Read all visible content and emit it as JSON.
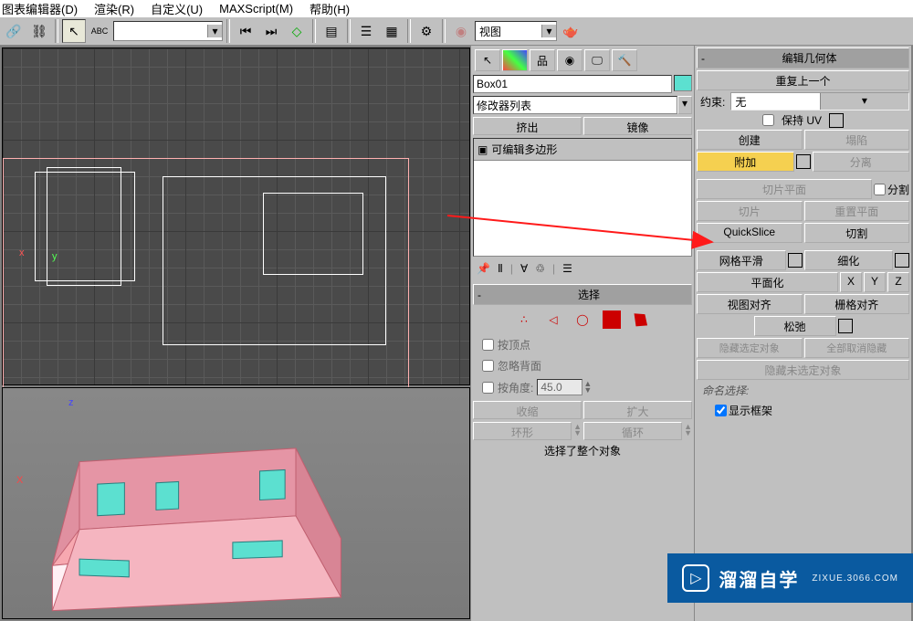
{
  "menubar": {
    "graph_editors": "图表编辑器(D)",
    "rendering": "渲染(R)",
    "customize": "自定义(U)",
    "maxscript": "MAXScript(M)",
    "help": "帮助(H)"
  },
  "toolbar": {
    "view_dropdown": "视图"
  },
  "cmd": {
    "object_name": "Box01",
    "modifier_list": "修改器列表",
    "extrude": "挤出",
    "mirror": "镜像",
    "editable_poly": "可编辑多边形",
    "selection_header": "选择",
    "by_vertex": "按顶点",
    "ignore_backfacing": "忽略背面",
    "by_angle": "按角度:",
    "angle_value": "45.0",
    "shrink": "收缩",
    "grow": "扩大",
    "ring": "环形",
    "loop": "循环",
    "select_whole_hint": "选择了整个对象"
  },
  "right": {
    "edit_geometry": "编辑几何体",
    "repeat_last": "重复上一个",
    "constraint_label": "约束:",
    "constraint_value": "无",
    "preserve_uv": "保持 UV",
    "create": "创建",
    "collapse": "塌陷",
    "attach": "附加",
    "detach": "分离",
    "slice_plane": "切片平面",
    "split": "分割",
    "slice": "切片",
    "reset_plane": "重置平面",
    "quickslice": "QuickSlice",
    "cut": "切割",
    "msmooth": "网格平滑",
    "tessellate": "细化",
    "make_planar": "平面化",
    "x": "X",
    "y": "Y",
    "z": "Z",
    "view_align": "视图对齐",
    "grid_align": "栅格对齐",
    "relax": "松弛",
    "hide_selected": "隐藏选定对象",
    "unhide_all": "全部取消隐藏",
    "hide_unselected": "隐藏未选定对象",
    "named_selections": "命名选择:",
    "show_cage": "显示框架"
  },
  "watermark": {
    "text": "溜溜自学",
    "url": "ZIXUE.3066.COM"
  }
}
